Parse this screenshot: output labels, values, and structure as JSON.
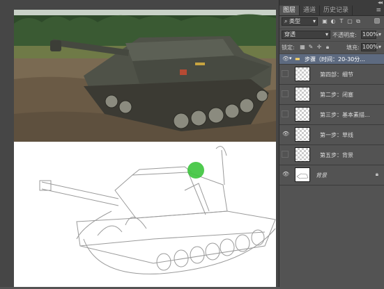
{
  "panel": {
    "tabs": [
      "图层",
      "通道",
      "历史记录"
    ],
    "active_tab": 0,
    "kind_filter_label": "类型",
    "blend_mode": "穿透",
    "opacity_label": "不透明度:",
    "opacity_value": "100%",
    "lock_label": "锁定:",
    "fill_label": "填充:",
    "fill_value": "100%",
    "menu_icon": "panel-menu-icon",
    "collapse_icon": "double-chevron-icon"
  },
  "layers": [
    {
      "name": "步骤（时间：20-30分...",
      "type": "group",
      "visible": true,
      "expanded": true
    },
    {
      "name": "第四部：细节",
      "type": "layer",
      "visible": false
    },
    {
      "name": "第二步：闭塞",
      "type": "layer",
      "visible": false
    },
    {
      "name": "第三步：基本素描...",
      "type": "layer",
      "visible": false
    },
    {
      "name": "第一步：草线",
      "type": "layer",
      "visible": true
    },
    {
      "name": "第五步：背景",
      "type": "layer",
      "visible": false
    },
    {
      "name": "背景",
      "type": "background",
      "visible": true,
      "locked": true
    }
  ],
  "colors": {
    "panel_bg": "#535353",
    "selected_group": "#5d6a80",
    "brush_marker": "#3cc43c"
  }
}
